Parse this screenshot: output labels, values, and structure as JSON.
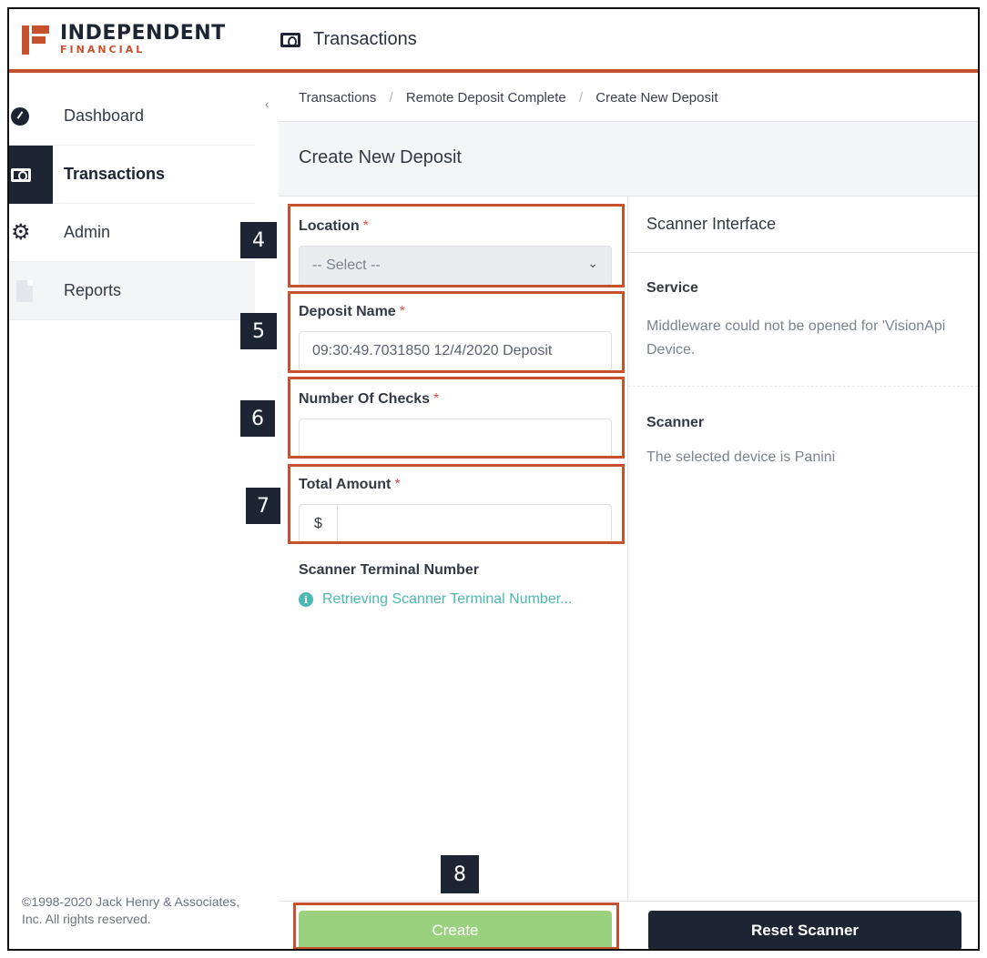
{
  "header": {
    "logo_line1": "INDEPENDENT",
    "logo_line2": "FINANCIAL",
    "page_title": "Transactions",
    "accent_color": "#c6512f"
  },
  "sidebar": {
    "items": [
      {
        "label": "Dashboard",
        "icon": "gauge-icon"
      },
      {
        "label": "Transactions",
        "icon": "money-icon",
        "active": true
      },
      {
        "label": "Admin",
        "icon": "cogs-icon"
      },
      {
        "label": "Reports",
        "icon": "document-icon"
      }
    ],
    "collapse_glyph": "‹",
    "admin_chevron": "›",
    "copyright": "©1998-2020 Jack Henry & Associates, Inc. All rights reserved."
  },
  "breadcrumb": {
    "items": [
      "Transactions",
      "Remote Deposit Complete",
      "Create New Deposit"
    ],
    "separator": "/"
  },
  "page": {
    "title": "Create New Deposit"
  },
  "form": {
    "required_mark": "*",
    "location": {
      "label": "Location",
      "value": "-- Select --"
    },
    "deposit_name": {
      "label": "Deposit Name",
      "value": "09:30:49.7031850 12/4/2020 Deposit"
    },
    "number_of_checks": {
      "label": "Number Of Checks",
      "value": ""
    },
    "total_amount": {
      "label": "Total Amount",
      "prefix": "$",
      "value": ""
    },
    "scanner_terminal": {
      "label": "Scanner Terminal Number",
      "status": "Retrieving Scanner Terminal Number..."
    }
  },
  "scanner_panel": {
    "title": "Scanner Interface",
    "service_label": "Service",
    "service_text": "Middleware could not be opened for 'VisionApi Device.",
    "scanner_label": "Scanner",
    "scanner_text": "The selected device is Panini"
  },
  "buttons": {
    "create": "Create",
    "reset_scanner": "Reset Scanner",
    "create_color": "#9ad17f",
    "reset_color": "#1d2433"
  },
  "annotations": {
    "badges": [
      "4",
      "5",
      "6",
      "7",
      "8"
    ],
    "highlight_color": "#c6512f"
  }
}
